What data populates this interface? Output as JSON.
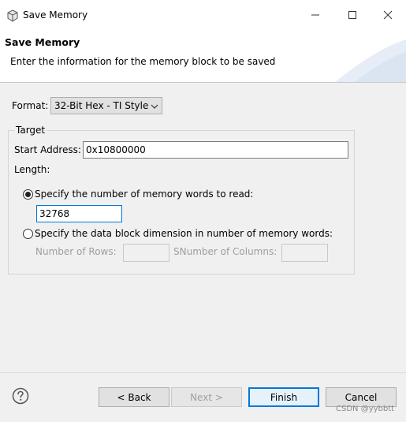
{
  "window": {
    "title": "Save Memory"
  },
  "header": {
    "title": "Save Memory",
    "description": "Enter the information for the memory block to be saved"
  },
  "format": {
    "label": "Format:",
    "selected": "32-Bit Hex - TI Style"
  },
  "target": {
    "legend": "Target",
    "start_address_label": "Start Address:",
    "start_address_value": "0x10800000",
    "length_label": "Length:",
    "option_words_label": "Specify the number of memory words to read:",
    "option_words_checked": true,
    "words_value": "32768",
    "option_block_label": "Specify the data block dimension in number of memory words:",
    "option_block_checked": false,
    "rows_label": "Number of Rows:",
    "rows_value": "",
    "columns_label": "SNumber of Columns:",
    "columns_value": ""
  },
  "buttons": {
    "back": "< Back",
    "next": "Next >",
    "finish": "Finish",
    "cancel": "Cancel"
  },
  "watermark": "CSDN @yybbtt",
  "icons": {
    "app": "cube-icon",
    "help": "help-icon",
    "minimize": "minimize-icon",
    "maximize": "maximize-icon",
    "close": "close-icon",
    "dropdown": "chevron-down-icon"
  }
}
